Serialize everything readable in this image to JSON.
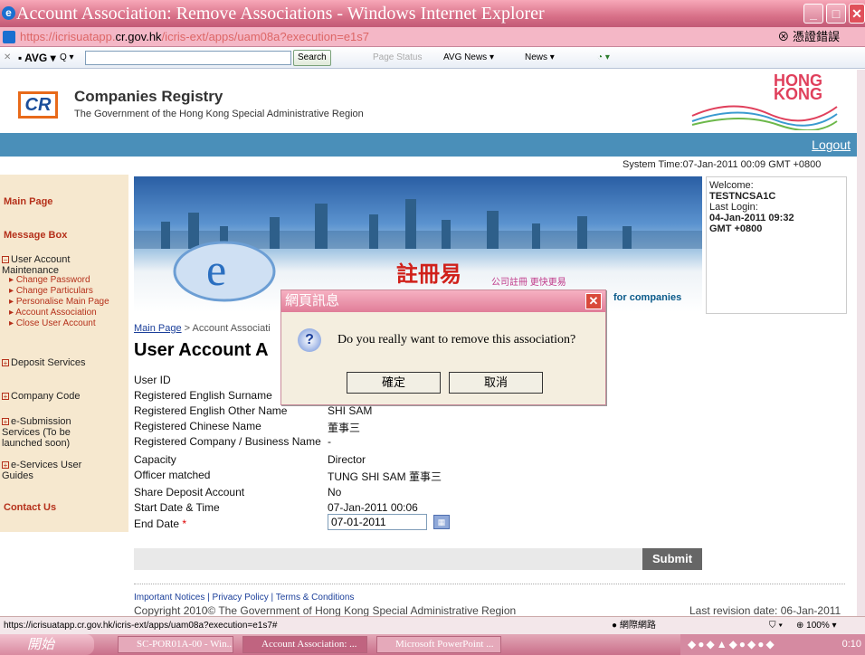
{
  "window": {
    "title": "Account Association: Remove Associations - Windows Internet Explorer",
    "min": "_",
    "max": "□",
    "close": "✕"
  },
  "address": {
    "prefix": "https://icrisuatapp.",
    "host": "cr.gov.hk",
    "path": "/icris-ext/apps/uam08a?execution=e1s7",
    "cert_error": "憑證錯誤"
  },
  "toolbar": {
    "avg": "AVG",
    "search_placeholder": "Q ▾",
    "search_btn": "Search",
    "page_status": "Page Status",
    "avg_news": "AVG News ▾",
    "news": "News ▾"
  },
  "header": {
    "logo": "CR",
    "org": "Companies Registry",
    "sub": "The Government of the Hong Kong Special Administrative Region",
    "hk1": "HONG",
    "hk2": "KONG"
  },
  "nav": {
    "logout": "Logout"
  },
  "system_time": "System Time:07-Jan-2011 00:09 GMT +0800",
  "sidebar": {
    "main_page": "Main Page",
    "message_box": "Message Box",
    "uam": "User Account Maintenance",
    "uam_items": [
      "Change Password",
      "Change Particulars",
      "Personalise Main Page",
      "Account Association",
      "Close User Account"
    ],
    "deposit": "Deposit Services",
    "company_code": "Company Code",
    "esub": "e-Submission Services (To be launched soon)",
    "eservices": "e-Services User Guides",
    "contact": "Contact Us"
  },
  "banner": {
    "brand": "註冊易",
    "slogan": "公司註冊 更快更易",
    "tag": "for companies"
  },
  "welcome": {
    "label": "Welcome:",
    "user": "TESTNCSA1C",
    "last_login_label": "Last Login:",
    "last_login": "04-Jan-2011 09:32 GMT +0800"
  },
  "breadcrumb": {
    "home": "Main Page",
    "current": "> Account Associati"
  },
  "page_title": "User Account A",
  "details": {
    "user_id": "User ID",
    "surname": "Registered English Surname",
    "other_name": "Registered English Other Name",
    "other_name_val": "SHI SAM",
    "chinese_name": "Registered Chinese Name",
    "chinese_name_val": "董事三",
    "company": "Registered Company / Business Name",
    "company_val": "-",
    "capacity": "Capacity",
    "capacity_val": "Director",
    "officer": "Officer matched",
    "officer_val": "TUNG SHI SAM 董事三",
    "share": "Share Deposit Account",
    "share_val": "No",
    "start": "Start Date & Time",
    "start_val": "07-Jan-2011 00:06",
    "end": "End Date",
    "end_required": "*",
    "end_val": "07-01-2011"
  },
  "submit": "Submit",
  "footer": {
    "links": "Important Notices | Privacy Policy | Terms & Conditions",
    "copyright": "Copyright 2010© The Government of Hong Kong Special Administrative Region",
    "last_rev": "Last revision date: 06-Jan-2011"
  },
  "dialog": {
    "title": "網頁訊息",
    "message": "Do you really want to remove this association?",
    "ok": "確定",
    "cancel": "取消"
  },
  "status": {
    "url": "https://icrisuatapp.cr.gov.hk/icris-ext/apps/uam08a?execution=e1s7#",
    "zone": "網際網路",
    "zoom": "100%"
  },
  "taskbar": {
    "start": "開始",
    "tasks": [
      "SC-POR01A-00 - Win...",
      "Account Association: ...",
      "Microsoft PowerPoint ..."
    ],
    "clock": "0:10"
  }
}
